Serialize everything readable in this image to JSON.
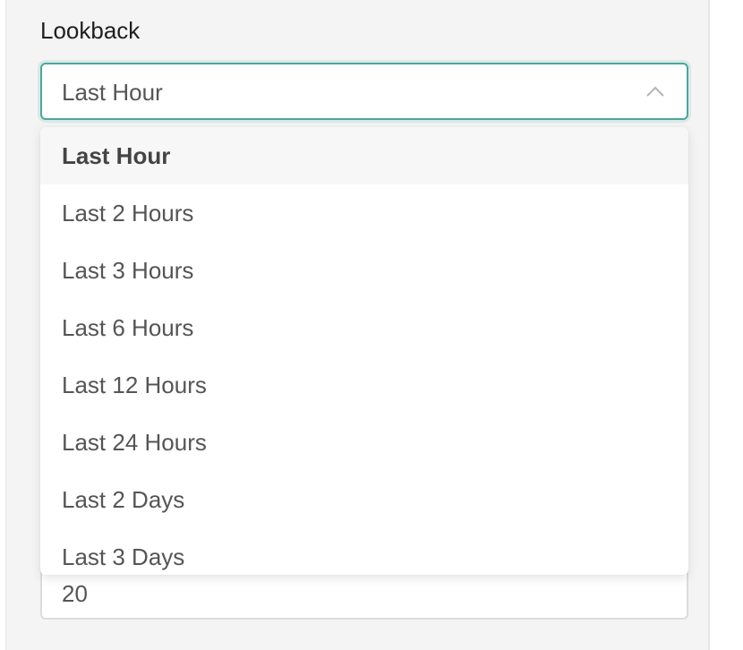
{
  "lookback": {
    "label": "Lookback",
    "selected_value": "Last Hour",
    "options": [
      "Last Hour",
      "Last 2 Hours",
      "Last 3 Hours",
      "Last 6 Hours",
      "Last 12 Hours",
      "Last 24 Hours",
      "Last 2 Days",
      "Last 3 Days"
    ],
    "selected_index": 0,
    "icon": "chevron-up-icon"
  },
  "number_field": {
    "value": "20"
  },
  "colors": {
    "focus_border": "#4aa89c",
    "panel_bg": "#f4f4f4",
    "text": "#555555"
  }
}
